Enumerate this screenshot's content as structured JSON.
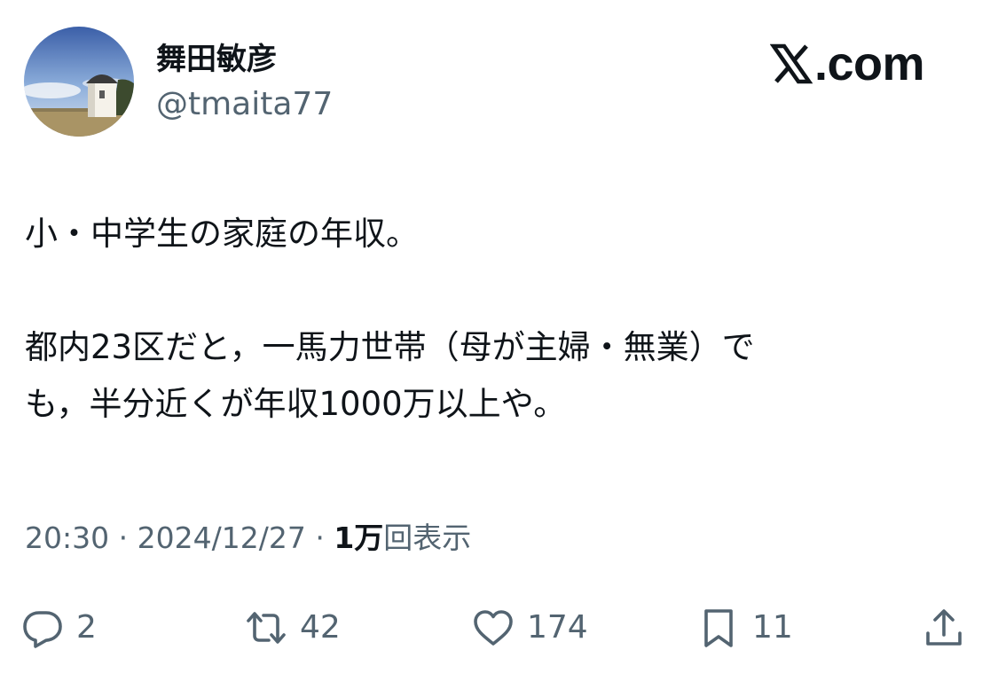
{
  "author": {
    "display_name": "舞田敏彦",
    "handle": "@tmaita77",
    "avatar": "lighthouse-photo-avatar"
  },
  "brand": {
    "icon": "x-logo-icon",
    "text": ".com"
  },
  "tweet": {
    "line1": "小・中学生の家庭の年収。",
    "line2": "都内23区だと，一馬力世帯（母が主婦・無業）で",
    "line3": "も，半分近くが年収1000万以上や。"
  },
  "meta": {
    "time": "20:30",
    "separator": "·",
    "date": "2024/12/27",
    "views_count": "1万",
    "views_label": "回表示"
  },
  "actions": {
    "reply": {
      "icon": "reply-bubble-icon",
      "count": "2"
    },
    "retweet": {
      "icon": "retweet-icon",
      "count": "42"
    },
    "like": {
      "icon": "heart-icon",
      "count": "174"
    },
    "bookmark": {
      "icon": "bookmark-icon",
      "count": "11"
    },
    "share": {
      "icon": "share-upload-icon"
    }
  },
  "colors": {
    "text": "#0f1419",
    "secondary": "#536471",
    "background": "#ffffff"
  }
}
